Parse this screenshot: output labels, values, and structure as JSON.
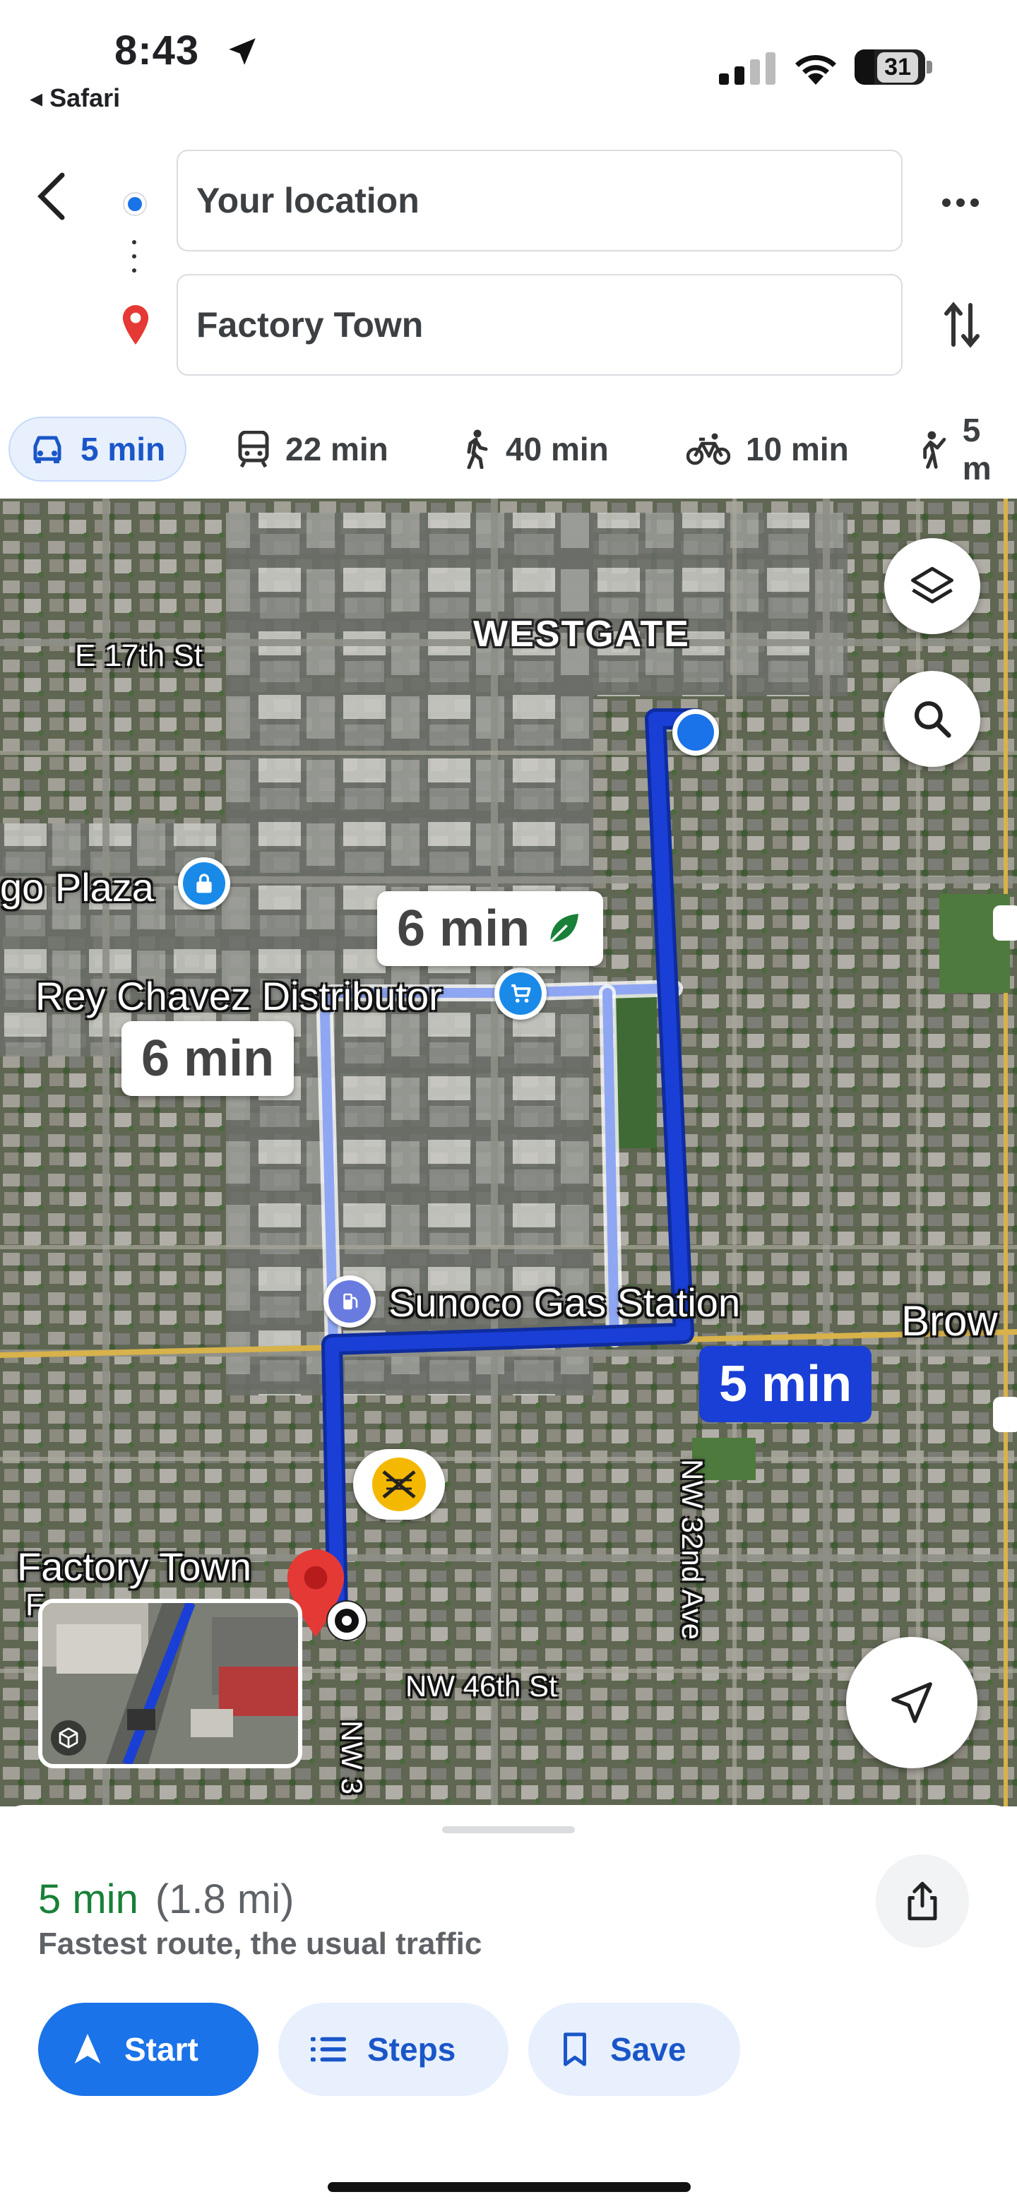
{
  "status_bar": {
    "time": "8:43",
    "back_app": "◂ Safari",
    "battery": "31"
  },
  "directions": {
    "from": "Your location",
    "to": "Factory Town"
  },
  "modes": [
    {
      "label": "5 min",
      "icon": "car-icon",
      "active": true
    },
    {
      "label": "22 min",
      "icon": "transit-icon"
    },
    {
      "label": "40 min",
      "icon": "walk-icon"
    },
    {
      "label": "10 min",
      "icon": "bike-icon"
    },
    {
      "label": "5 m",
      "icon": "rideshare-icon"
    }
  ],
  "map": {
    "labels": {
      "westgate": "WESTGATE",
      "e17th": "E 17th St",
      "plaza": "go Plaza",
      "rey": "Rey Chavez Distributor",
      "sunoco": "Sunoco Gas Station",
      "brow": "Brow",
      "factory": "Factory Town",
      "factory_sub": "F",
      "nw32": "NW 32nd Ave",
      "nw46": "NW 46th St",
      "nw3": "NW 3"
    },
    "callouts": {
      "alt1": "6 min",
      "alt2": "6 min",
      "main": "5 min"
    },
    "colors": {
      "route_primary": "#1a3fd6",
      "route_alt": "#8fa7f2"
    }
  },
  "sheet": {
    "duration": "5 min",
    "distance": "(1.8 mi)",
    "description": "Fastest route, the usual traffic",
    "start_label": "Start",
    "steps_label": "Steps",
    "save_label": "Save"
  }
}
